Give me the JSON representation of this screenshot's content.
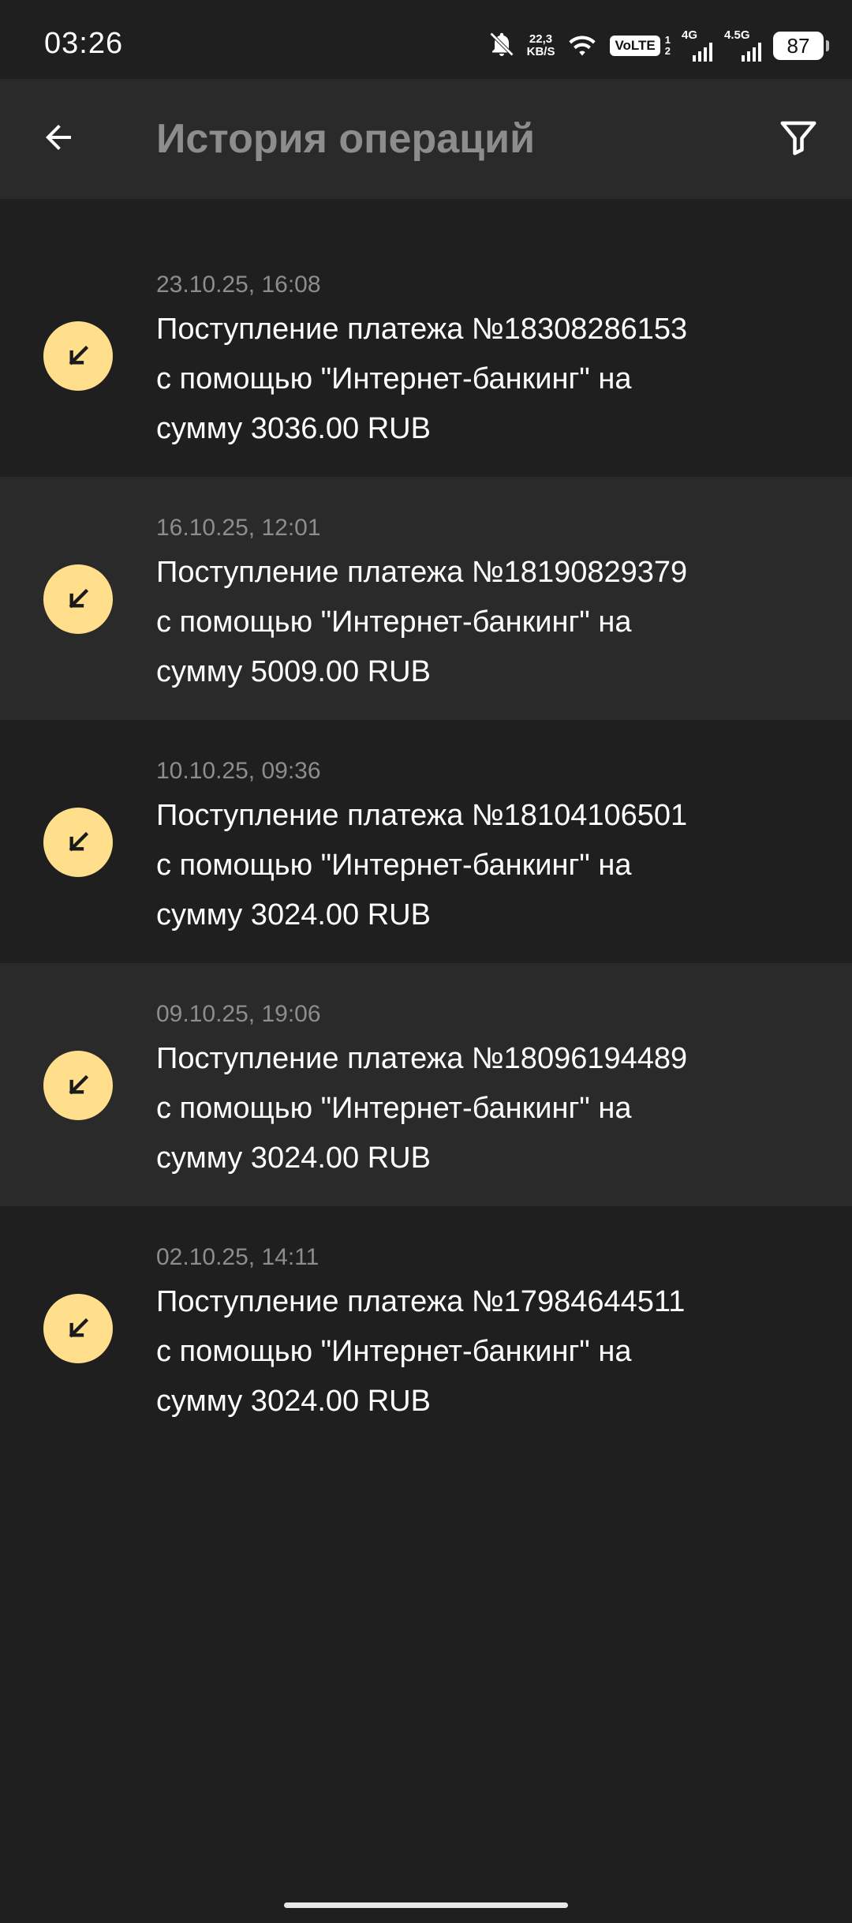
{
  "status_bar": {
    "time": "03:26",
    "net_speed_value": "22,3",
    "net_speed_unit": "KB/S",
    "volte": "VoLTE",
    "sim_index_top": "1",
    "sim_index_bottom": "2",
    "network1": "4G",
    "network2": "4.5G",
    "battery": "87",
    "icons": [
      "bell-muted-icon",
      "wifi-icon",
      "signal-icon",
      "battery-icon"
    ]
  },
  "header": {
    "title": "История операций",
    "back_icon": "arrow-left-icon",
    "filter_icon": "filter-icon"
  },
  "transactions": [
    {
      "date": "23.10.25, 16:08",
      "description": "Поступление платежа №18308286153\nс помощью \"Интернет-банкинг\" на\nсумму 3036.00 RUB",
      "icon": "incoming-arrow-icon"
    },
    {
      "date": "16.10.25, 12:01",
      "description": "Поступление платежа №18190829379\nс помощью \"Интернет-банкинг\" на\nсумму 5009.00 RUB",
      "icon": "incoming-arrow-icon"
    },
    {
      "date": "10.10.25, 09:36",
      "description": "Поступление платежа №18104106501\nс помощью \"Интернет-банкинг\" на\nсумму 3024.00 RUB",
      "icon": "incoming-arrow-icon"
    },
    {
      "date": "09.10.25, 19:06",
      "description": "Поступление платежа №18096194489\nс помощью \"Интернет-банкинг\" на\nсумму 3024.00 RUB",
      "icon": "incoming-arrow-icon"
    },
    {
      "date": "02.10.25, 14:11",
      "description": "Поступление платежа №17984644511\nс помощью \"Интернет-банкинг\" на\nсумму 3024.00 RUB",
      "icon": "incoming-arrow-icon"
    }
  ],
  "colors": {
    "background": "#1f1f1f",
    "surface": "#2a2a2a",
    "accent": "#ffdf8c",
    "muted_text": "#8d8d8d",
    "text": "#ffffff"
  }
}
